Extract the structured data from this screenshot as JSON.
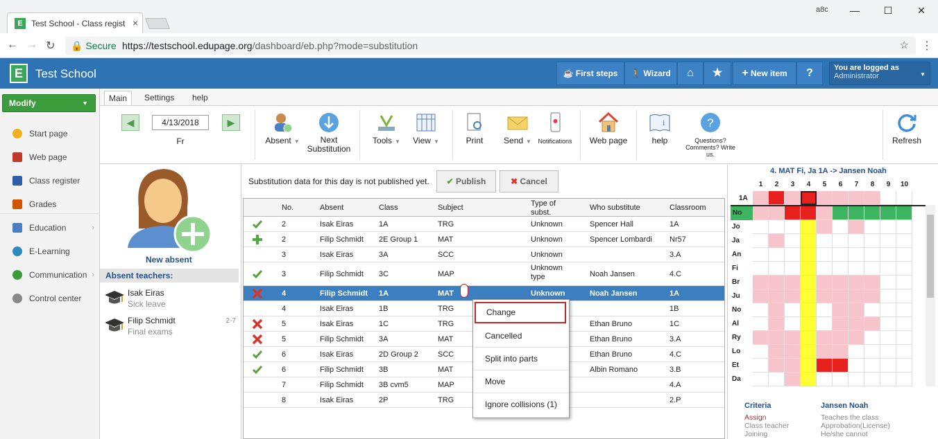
{
  "browser": {
    "tab_title": "Test School - Class regist",
    "tab_close": "×",
    "ext_label": "a8c",
    "secure": "Secure",
    "url_host": "https://testschool.edupage.org",
    "url_path": "/dashboard/eb.php?mode=substitution",
    "win_min": "—",
    "win_max": "☐",
    "win_close": "✕"
  },
  "header": {
    "app_name": "Test School",
    "logo": "E",
    "first_steps": "First steps",
    "wizard": "Wizard",
    "new_item": "New item",
    "help_q": "?",
    "logged_label": "You are logged as",
    "logged_user": "Administrator"
  },
  "sidebar": {
    "modify": "Modify",
    "items": [
      {
        "label": "Start page",
        "color": "#f0b020"
      },
      {
        "label": "Web page",
        "color": "#c0392b"
      },
      {
        "label": "Class register",
        "color": "#2e5fa8"
      },
      {
        "label": "Grades",
        "color": "#d35400"
      },
      {
        "label": "Education",
        "color": "#4a7fc1"
      },
      {
        "label": "E-Learning",
        "color": "#2e8bc0"
      },
      {
        "label": "Communication",
        "color": "#3a9c3a"
      },
      {
        "label": "Control center",
        "color": "#888888"
      }
    ]
  },
  "ribbon": {
    "tabs": [
      "Main",
      "Settings",
      "help"
    ],
    "date": "4/13/2018",
    "day": "Fr",
    "absent": "Absent",
    "next_sub_1": "Next",
    "next_sub_2": "Substitution",
    "tools": "Tools",
    "view": "View",
    "print": "Print",
    "send": "Send",
    "notifications": "Notifications",
    "web_page": "Web page",
    "help": "help",
    "questions": "Questions? Comments? Write us.",
    "refresh": "Refresh"
  },
  "absent_panel": {
    "new_absent": "New absent",
    "header": "Absent teachers:",
    "teachers": [
      {
        "name": "Isak Eiras",
        "reason": "Sick leave",
        "periods": ""
      },
      {
        "name": "Filip Schmidt",
        "reason": "Final exams",
        "periods": "2-7"
      }
    ]
  },
  "main": {
    "publish_msg": "Substitution data for this day is not published yet.",
    "publish_btn": "Publish",
    "cancel_btn": "Cancel",
    "columns": [
      "No.",
      "Absent",
      "Class",
      "Subject",
      "Type of subst.",
      "Who substitute",
      "Classroom"
    ],
    "rows": [
      {
        "icon": "check",
        "no": "2",
        "absent": "Isak Eiras",
        "class": "1A",
        "subject": "TRG",
        "type": "Unknown",
        "who": "Spencer Hall",
        "room": "1A"
      },
      {
        "icon": "plus",
        "no": "2",
        "absent": "Filip Schmidt",
        "class": "2E Group 1",
        "subject": "MAT",
        "type": "Unknown",
        "who": "Spencer Lombardi",
        "room": "Nr57"
      },
      {
        "icon": "",
        "no": "3",
        "absent": "Isak Eiras",
        "class": "3A",
        "subject": "SCC",
        "type": "Unknown",
        "who": "",
        "room": "3.A"
      },
      {
        "icon": "check",
        "no": "3",
        "absent": "Filip Schmidt",
        "class": "3C",
        "subject": "MAP",
        "type": "Unknown type",
        "who": "Noah Jansen",
        "room": "4.C"
      },
      {
        "icon": "cross",
        "no": "4",
        "absent": "Filip Schmidt",
        "class": "1A",
        "subject": "MAT",
        "type": "Unknown",
        "who": "Noah Jansen",
        "room": "1A"
      },
      {
        "icon": "",
        "no": "4",
        "absent": "Isak Eiras",
        "class": "1B",
        "subject": "TRG",
        "type": "",
        "who": "",
        "room": "1B"
      },
      {
        "icon": "cross",
        "no": "5",
        "absent": "Isak Eiras",
        "class": "1C",
        "subject": "TRG",
        "type": "",
        "who": "Ethan Bruno",
        "room": "1C"
      },
      {
        "icon": "cross",
        "no": "5",
        "absent": "Filip Schmidt",
        "class": "3A",
        "subject": "MAT",
        "type": "",
        "who": "Ethan Bruno",
        "room": "3.A"
      },
      {
        "icon": "check",
        "no": "6",
        "absent": "Isak Eiras",
        "class": "2D Group 2",
        "subject": "SCC",
        "type": "",
        "who": "Ethan Bruno",
        "room": "4.C"
      },
      {
        "icon": "check",
        "no": "6",
        "absent": "Filip Schmidt",
        "class": "3B",
        "subject": "MAT",
        "type": "",
        "who": "Albin Romano",
        "room": "3.B"
      },
      {
        "icon": "",
        "no": "7",
        "absent": "Filip Schmidt",
        "class": "3B cvm5",
        "subject": "MAP",
        "type": "",
        "who": "",
        "room": "4.A"
      },
      {
        "icon": "",
        "no": "8",
        "absent": "Isak Eiras",
        "class": "2P",
        "subject": "TRG",
        "type": "",
        "who": "",
        "room": "2.P"
      }
    ],
    "selected_row": 4
  },
  "context_menu": {
    "items": [
      "Change",
      "Cancelled",
      "Split into parts",
      "Move",
      "Ignore collisions (1)"
    ]
  },
  "timetable": {
    "title": "4. MAT Fi, Ja 1A -> Jansen Noah",
    "class_label": "1A",
    "periods": [
      "1",
      "2",
      "3",
      "4",
      "5",
      "6",
      "7",
      "8",
      "9",
      "10"
    ],
    "rows": [
      "No",
      "Jo",
      "Ja",
      "An",
      "Fi",
      "Br",
      "Ju",
      "No",
      "Al",
      "Ry",
      "Lo",
      "Et",
      "Da"
    ],
    "criteria_label": "Criteria",
    "criteria_name": "Jansen Noah",
    "criteria_left": [
      "Assign",
      "Class teacher",
      "Joining"
    ],
    "criteria_right": [
      "Teaches the class",
      "Approbation(License)",
      "He/she cannot"
    ]
  }
}
